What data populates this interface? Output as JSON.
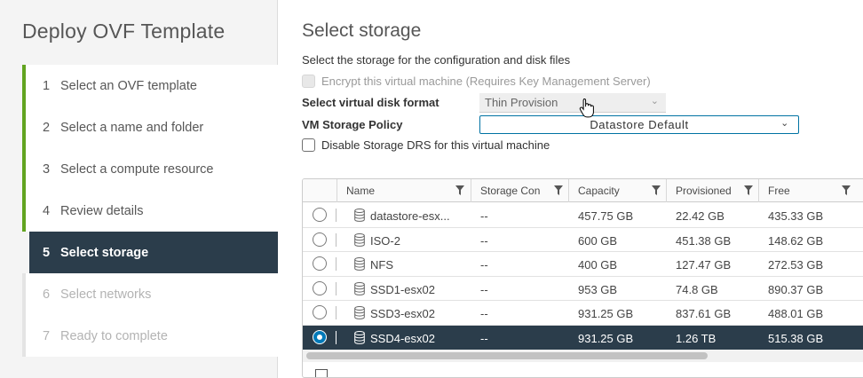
{
  "wizard": {
    "title": "Deploy OVF Template",
    "steps": [
      {
        "num": "1",
        "label": "Select an OVF template"
      },
      {
        "num": "2",
        "label": "Select a name and folder"
      },
      {
        "num": "3",
        "label": "Select a compute resource"
      },
      {
        "num": "4",
        "label": "Review details"
      },
      {
        "num": "5",
        "label": "Select storage"
      },
      {
        "num": "6",
        "label": "Select networks"
      },
      {
        "num": "7",
        "label": "Ready to complete"
      }
    ]
  },
  "page": {
    "title": "Select storage",
    "description": "Select the storage for the configuration and disk files",
    "encrypt_label": "Encrypt this virtual machine (Requires Key Management Server)",
    "disk_format_label": "Select virtual disk format",
    "disk_format_value": "Thin Provision",
    "policy_label": "VM Storage Policy",
    "policy_value": "Datastore Default",
    "disable_drs_label": "Disable Storage DRS for this virtual machine"
  },
  "grid": {
    "columns": [
      "Name",
      "Storage Con",
      "Capacity",
      "Provisioned",
      "Free"
    ],
    "rows": [
      {
        "name": "datastore-esx...",
        "storage": "--",
        "capacity": "457.75 GB",
        "provisioned": "22.42 GB",
        "free": "435.33 GB"
      },
      {
        "name": "ISO-2",
        "storage": "--",
        "capacity": "600 GB",
        "provisioned": "451.38 GB",
        "free": "148.62 GB"
      },
      {
        "name": "NFS",
        "storage": "--",
        "capacity": "400 GB",
        "provisioned": "127.47 GB",
        "free": "272.53 GB"
      },
      {
        "name": "SSD1-esx02",
        "storage": "--",
        "capacity": "953 GB",
        "provisioned": "74.8 GB",
        "free": "890.37 GB"
      },
      {
        "name": "SSD3-esx02",
        "storage": "--",
        "capacity": "931.25 GB",
        "provisioned": "837.61 GB",
        "free": "488.01 GB"
      },
      {
        "name": "SSD4-esx02",
        "storage": "--",
        "capacity": "931.25 GB",
        "provisioned": "1.26 TB",
        "free": "515.38 GB"
      }
    ],
    "selected_row": 5
  },
  "colors": {
    "accent_done": "#62a420",
    "active_bg": "#2b3d4b",
    "radio_on": "#0079b8",
    "policy_border": "#0072a3"
  }
}
